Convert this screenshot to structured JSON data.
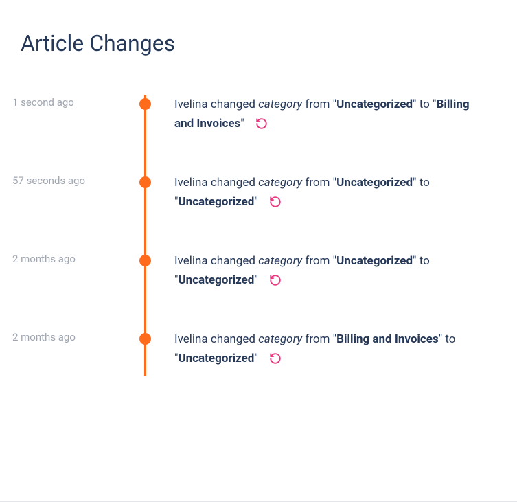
{
  "title": "Article Changes",
  "changeVerb": "changed",
  "fromWord": "from",
  "toWord": "to",
  "changes": [
    {
      "time": "1 second ago",
      "user": "Ivelina",
      "field": "category",
      "from": "Uncategorized",
      "to": "Billing and Invoices"
    },
    {
      "time": "57 seconds ago",
      "user": "Ivelina",
      "field": "category",
      "from": "Uncategorized",
      "to": "Uncategorized"
    },
    {
      "time": "2 months ago",
      "user": "Ivelina",
      "field": "category",
      "from": "Uncategorized",
      "to": "Uncategorized"
    },
    {
      "time": "2 months ago",
      "user": "Ivelina",
      "field": "category",
      "from": "Billing and Invoices",
      "to": "Uncategorized"
    }
  ]
}
